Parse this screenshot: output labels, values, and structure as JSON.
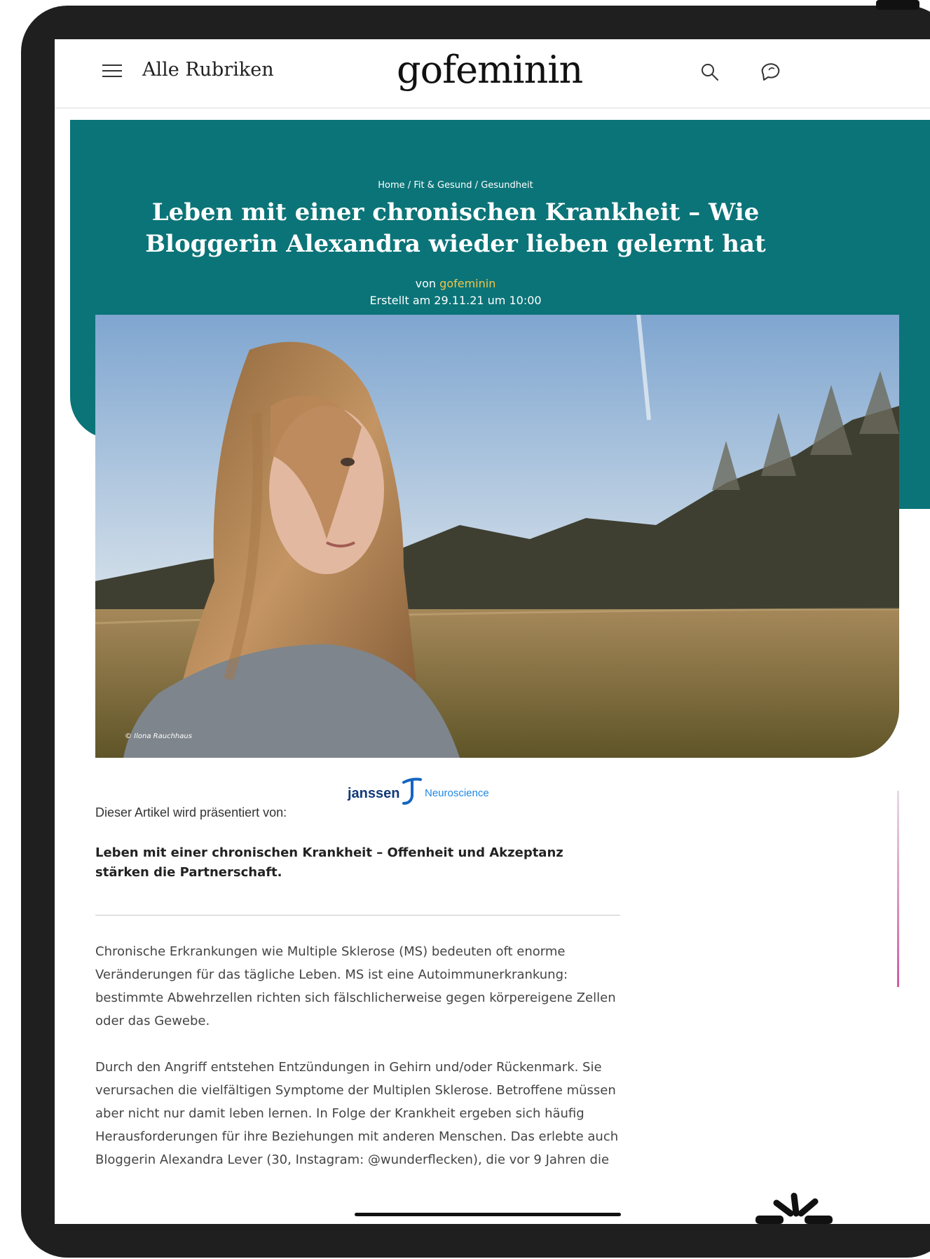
{
  "header": {
    "menu_label": "Alle Rubriken",
    "logo_text": "gofeminin",
    "icons": {
      "menu": "hamburger-icon",
      "search": "search-icon",
      "chat": "chat-icon"
    }
  },
  "hero": {
    "breadcrumb": [
      "Home",
      "Fit & Gesund",
      "Gesundheit"
    ],
    "breadcrumb_separator": " / ",
    "title": "Leben mit einer chronischen Krankheit – Wie Bloggerin Alexandra wieder lieben gelernt hat",
    "author_prefix": "von",
    "author": "gofeminin",
    "created": "Erstellt am 29.11.21 um 10:00",
    "image_credit": "© Ilona Rauchhaus",
    "colors": {
      "background": "#0b7478",
      "author": "#f2c64a"
    }
  },
  "article": {
    "sponsor_label": "Dieser Artikel wird präsentiert von:",
    "sponsor_name": "janssen",
    "sponsor_sub": "Neuroscience",
    "lead": "Leben mit einer chronischen Krankheit – Offenheit und Akzeptanz stärken die Partnerschaft.",
    "paragraphs": [
      "Chronische Erkrankungen wie Multiple Sklerose (MS) bedeuten oft enorme Veränderungen für das tägliche Leben. MS ist eine Autoimmunerkrankung: bestimmte Abwehrzellen richten sich fälschlicherweise gegen körpereigene Zellen oder das Gewebe.",
      "Durch den Angriff entstehen Entzündungen in Gehirn und/oder Rückenmark. Sie verursachen die vielfältigen Symptome der Multiplen Sklerose. Betroffene müssen aber nicht nur damit leben lernen. In Folge der Krankheit ergeben sich häufig Herausforderungen für ihre Beziehungen mit anderen Menschen. Das erlebte auch Bloggerin Alexandra Lever (30, Instagram: @wunderflecken), die vor 9 Jahren die"
    ]
  }
}
